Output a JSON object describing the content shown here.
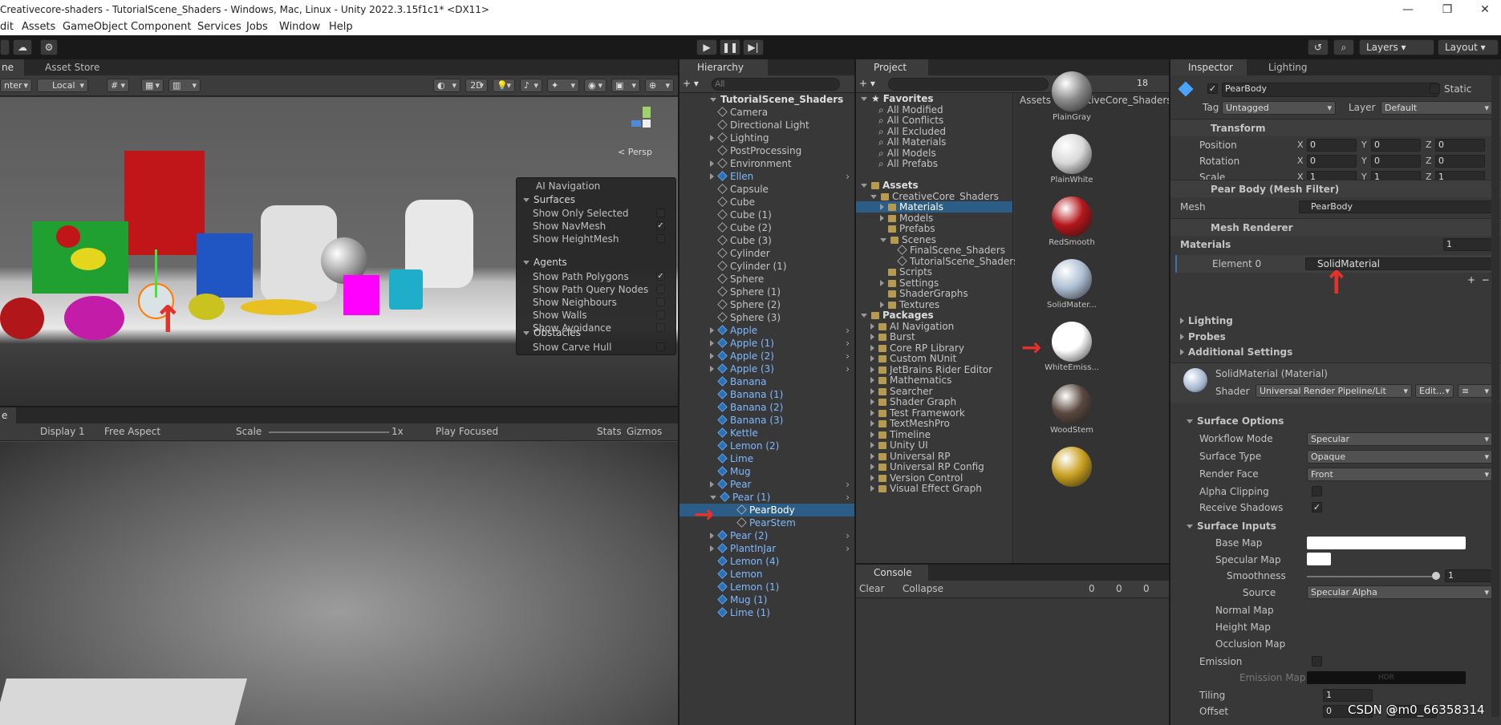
{
  "window": {
    "title": "Creativecore-shaders - TutorialScene_Shaders - Windows, Mac, Linux - Unity 2022.3.15f1c1* <DX11>",
    "controls": [
      "—",
      "❐",
      "✕"
    ]
  },
  "menu": [
    "dit",
    "Assets",
    "GameObject",
    "Component",
    "Services",
    "Jobs",
    "Window",
    "Help"
  ],
  "toolbar": {
    "layers": "Layers",
    "layout": "Layout"
  },
  "scene": {
    "tabs": [
      "ne",
      "Asset Store"
    ],
    "pivot": "nter",
    "space": "Local",
    "mode_2d": "2D",
    "persp": "< Persp",
    "overlay": {
      "title": "AI Navigation",
      "surfaces": "Surfaces",
      "surface_items": [
        {
          "label": "Show Only Selected",
          "checked": false
        },
        {
          "label": "Show NavMesh",
          "checked": true
        },
        {
          "label": "Show HeightMesh",
          "checked": false
        }
      ],
      "agents": "Agents",
      "agent_items": [
        {
          "label": "Show Path Polygons",
          "checked": true
        },
        {
          "label": "Show Path Query Nodes",
          "checked": false
        },
        {
          "label": "Show Neighbours",
          "checked": false
        },
        {
          "label": "Show Walls",
          "checked": false
        },
        {
          "label": "Show Avoidance",
          "checked": false
        }
      ],
      "obstacles": "Obstacles",
      "obstacle_items": [
        {
          "label": "Show Carve Hull",
          "checked": false
        }
      ]
    }
  },
  "game": {
    "tab": "e",
    "display": "Display 1",
    "aspect": "Free Aspect",
    "scale_label": "Scale",
    "scale_value": "1x",
    "play_mode": "Play Focused",
    "stats": "Stats",
    "gizmos": "Gizmos"
  },
  "hierarchy": {
    "tab": "Hierarchy",
    "search_placeholder": "All",
    "scene": "TutorialScene_Shaders",
    "items": [
      {
        "label": "Camera",
        "indent": 1,
        "prefab": false,
        "expand": false
      },
      {
        "label": "Directional Light",
        "indent": 1,
        "prefab": false,
        "expand": false
      },
      {
        "label": "Lighting",
        "indent": 1,
        "prefab": false,
        "expand": true
      },
      {
        "label": "PostProcessing",
        "indent": 1,
        "prefab": false,
        "expand": false
      },
      {
        "label": "Environment",
        "indent": 1,
        "prefab": false,
        "expand": true
      },
      {
        "label": "Ellen",
        "indent": 1,
        "prefab": true,
        "expand": true
      },
      {
        "label": "Capsule",
        "indent": 1,
        "prefab": false,
        "expand": false
      },
      {
        "label": "Cube",
        "indent": 1,
        "prefab": false,
        "expand": false
      },
      {
        "label": "Cube (1)",
        "indent": 1,
        "prefab": false,
        "expand": false
      },
      {
        "label": "Cube (2)",
        "indent": 1,
        "prefab": false,
        "expand": false
      },
      {
        "label": "Cube (3)",
        "indent": 1,
        "prefab": false,
        "expand": false
      },
      {
        "label": "Cylinder",
        "indent": 1,
        "prefab": false,
        "expand": false
      },
      {
        "label": "Cylinder (1)",
        "indent": 1,
        "prefab": false,
        "expand": false
      },
      {
        "label": "Sphere",
        "indent": 1,
        "prefab": false,
        "expand": false
      },
      {
        "label": "Sphere (1)",
        "indent": 1,
        "prefab": false,
        "expand": false
      },
      {
        "label": "Sphere (2)",
        "indent": 1,
        "prefab": false,
        "expand": false
      },
      {
        "label": "Sphere (3)",
        "indent": 1,
        "prefab": false,
        "expand": false
      },
      {
        "label": "Apple",
        "indent": 1,
        "prefab": true,
        "expand": true
      },
      {
        "label": "Apple (1)",
        "indent": 1,
        "prefab": true,
        "expand": true
      },
      {
        "label": "Apple (2)",
        "indent": 1,
        "prefab": true,
        "expand": true
      },
      {
        "label": "Apple (3)",
        "indent": 1,
        "prefab": true,
        "expand": true
      },
      {
        "label": "Banana",
        "indent": 1,
        "prefab": true,
        "expand": false
      },
      {
        "label": "Banana (1)",
        "indent": 1,
        "prefab": true,
        "expand": false
      },
      {
        "label": "Banana (2)",
        "indent": 1,
        "prefab": true,
        "expand": false
      },
      {
        "label": "Banana (3)",
        "indent": 1,
        "prefab": true,
        "expand": false
      },
      {
        "label": "Kettle",
        "indent": 1,
        "prefab": true,
        "expand": false
      },
      {
        "label": "Lemon (2)",
        "indent": 1,
        "prefab": true,
        "expand": false
      },
      {
        "label": "Lime",
        "indent": 1,
        "prefab": true,
        "expand": false
      },
      {
        "label": "Mug",
        "indent": 1,
        "prefab": true,
        "expand": false
      },
      {
        "label": "Pear",
        "indent": 1,
        "prefab": true,
        "expand": true
      },
      {
        "label": "Pear (1)",
        "indent": 1,
        "prefab": true,
        "expand": "open"
      },
      {
        "label": "PearBody",
        "indent": 2,
        "prefab": false,
        "expand": false,
        "selected": true
      },
      {
        "label": "PearStem",
        "indent": 2,
        "prefab": false,
        "expand": false,
        "blue": true
      },
      {
        "label": "Pear (2)",
        "indent": 1,
        "prefab": true,
        "expand": true
      },
      {
        "label": "PlantInJar",
        "indent": 1,
        "prefab": true,
        "expand": true
      },
      {
        "label": "Lemon (4)",
        "indent": 1,
        "prefab": true,
        "expand": false
      },
      {
        "label": "Lemon",
        "indent": 1,
        "prefab": true,
        "expand": false
      },
      {
        "label": "Lemon (1)",
        "indent": 1,
        "prefab": true,
        "expand": false
      },
      {
        "label": "Mug (1)",
        "indent": 1,
        "prefab": true,
        "expand": false
      },
      {
        "label": "Lime (1)",
        "indent": 1,
        "prefab": true,
        "expand": false
      }
    ]
  },
  "project": {
    "tab": "Project",
    "hidden_count": "18",
    "breadcrumb": "Assets > CreativeCore_Shaders",
    "tree": [
      {
        "label": "Favorites",
        "indent": 0,
        "kind": "star",
        "open": true,
        "bold": true
      },
      {
        "label": "All Modified",
        "indent": 1,
        "kind": "search"
      },
      {
        "label": "All Conflicts",
        "indent": 1,
        "kind": "search"
      },
      {
        "label": "All Excluded",
        "indent": 1,
        "kind": "search"
      },
      {
        "label": "All Materials",
        "indent": 1,
        "kind": "search"
      },
      {
        "label": "All Models",
        "indent": 1,
        "kind": "search"
      },
      {
        "label": "All Prefabs",
        "indent": 1,
        "kind": "search"
      },
      {
        "label": "",
        "indent": 0,
        "kind": "gap"
      },
      {
        "label": "Assets",
        "indent": 0,
        "kind": "folder",
        "open": true,
        "bold": true
      },
      {
        "label": "CreativeCore_Shaders",
        "indent": 1,
        "kind": "folder",
        "open": true
      },
      {
        "label": "Materials",
        "indent": 2,
        "kind": "folder",
        "collapsed": true,
        "selected": true
      },
      {
        "label": "Models",
        "indent": 2,
        "kind": "folder",
        "collapsed": true
      },
      {
        "label": "Prefabs",
        "indent": 2,
        "kind": "folder"
      },
      {
        "label": "Scenes",
        "indent": 2,
        "kind": "folder",
        "open": true
      },
      {
        "label": "FinalScene_Shaders",
        "indent": 3,
        "kind": "scene"
      },
      {
        "label": "TutorialScene_Shaders",
        "indent": 3,
        "kind": "scene"
      },
      {
        "label": "Scripts",
        "indent": 2,
        "kind": "folder"
      },
      {
        "label": "Settings",
        "indent": 2,
        "kind": "folder",
        "collapsed": true
      },
      {
        "label": "ShaderGraphs",
        "indent": 2,
        "kind": "folder"
      },
      {
        "label": "Textures",
        "indent": 2,
        "kind": "folder",
        "collapsed": true
      },
      {
        "label": "Packages",
        "indent": 0,
        "kind": "folder",
        "open": true,
        "bold": true
      },
      {
        "label": "AI Navigation",
        "indent": 1,
        "kind": "folder",
        "collapsed": true
      },
      {
        "label": "Burst",
        "indent": 1,
        "kind": "folder",
        "collapsed": true
      },
      {
        "label": "Core RP Library",
        "indent": 1,
        "kind": "folder",
        "collapsed": true
      },
      {
        "label": "Custom NUnit",
        "indent": 1,
        "kind": "folder",
        "collapsed": true
      },
      {
        "label": "JetBrains Rider Editor",
        "indent": 1,
        "kind": "folder",
        "collapsed": true
      },
      {
        "label": "Mathematics",
        "indent": 1,
        "kind": "folder",
        "collapsed": true
      },
      {
        "label": "Searcher",
        "indent": 1,
        "kind": "folder",
        "collapsed": true
      },
      {
        "label": "Shader Graph",
        "indent": 1,
        "kind": "folder",
        "collapsed": true
      },
      {
        "label": "Test Framework",
        "indent": 1,
        "kind": "folder",
        "collapsed": true
      },
      {
        "label": "TextMeshPro",
        "indent": 1,
        "kind": "folder",
        "collapsed": true
      },
      {
        "label": "Timeline",
        "indent": 1,
        "kind": "folder",
        "collapsed": true
      },
      {
        "label": "Unity UI",
        "indent": 1,
        "kind": "folder",
        "collapsed": true
      },
      {
        "label": "Universal RP",
        "indent": 1,
        "kind": "folder",
        "collapsed": true
      },
      {
        "label": "Universal RP Config",
        "indent": 1,
        "kind": "folder",
        "collapsed": true
      },
      {
        "label": "Version Control",
        "indent": 1,
        "kind": "folder",
        "collapsed": true
      },
      {
        "label": "Visual Effect Graph",
        "indent": 1,
        "kind": "folder",
        "collapsed": true
      }
    ],
    "materials": [
      {
        "name": "PlainGray",
        "color": "#8a8a8a"
      },
      {
        "name": "PlainWhite",
        "color": "#d9d9d9"
      },
      {
        "name": "RedSmooth",
        "color": "#b3161a"
      },
      {
        "name": "SolidMater...",
        "color": "#aebfd4"
      },
      {
        "name": "WhiteEmiss...",
        "color": "#ffffff"
      },
      {
        "name": "WoodStem",
        "color": "#5a4840"
      },
      {
        "name": "",
        "color": "#c9a020"
      }
    ]
  },
  "console": {
    "tab": "Console",
    "clear": "Clear",
    "collapse": "Collapse",
    "counts": [
      "0",
      "0",
      "0"
    ]
  },
  "inspector": {
    "tabs": [
      "Inspector",
      "Lighting"
    ],
    "object_name": "PearBody",
    "static_label": "Static",
    "tag_label": "Tag",
    "tag": "Untagged",
    "layer_label": "Layer",
    "layer": "Default",
    "transform": {
      "title": "Transform",
      "rows": [
        {
          "label": "Position",
          "x": "0",
          "y": "0",
          "z": "0"
        },
        {
          "label": "Rotation",
          "x": "0",
          "y": "0",
          "z": "0"
        },
        {
          "label": "Scale",
          "x": "1",
          "y": "1",
          "z": "1"
        }
      ]
    },
    "mesh_filter": {
      "title": "Pear Body (Mesh Filter)",
      "mesh_label": "Mesh",
      "mesh": "PearBody"
    },
    "mesh_renderer": {
      "title": "Mesh Renderer",
      "materials_label": "Materials",
      "materials_count": "1",
      "element_label": "Element 0",
      "element_value": "SolidMaterial",
      "lighting": "Lighting",
      "probes": "Probes",
      "additional": "Additional Settings"
    },
    "material": {
      "title": "SolidMaterial (Material)",
      "shader_label": "Shader",
      "shader": "Universal Render Pipeline/Lit",
      "edit": "Edit...",
      "surface_options": "Surface Options",
      "options": [
        {
          "label": "Workflow Mode",
          "value": "Specular"
        },
        {
          "label": "Surface Type",
          "value": "Opaque"
        },
        {
          "label": "Render Face",
          "value": "Front"
        }
      ],
      "alpha_clipping": "Alpha Clipping",
      "receive_shadows": "Receive Shadows",
      "surface_inputs": "Surface Inputs",
      "base_map": "Base Map",
      "specular_map": "Specular Map",
      "smoothness": "Smoothness",
      "smoothness_value": "1",
      "source": "Source",
      "source_value": "Specular Alpha",
      "normal_map": "Normal Map",
      "height_map": "Height Map",
      "occlusion_map": "Occlusion Map",
      "emission": "Emission",
      "emission_map": "Emission Map",
      "hdr": "HDR",
      "tiling": "Tiling",
      "tiling_x": "1",
      "offset": "Offset",
      "offset_x": "0",
      "offset_y": "0"
    }
  },
  "watermark": "CSDN @m0_66358314",
  "colors": {
    "accent": "#2c5d87",
    "prefab": "#7fb9ff",
    "annotation": "#e3322a"
  }
}
